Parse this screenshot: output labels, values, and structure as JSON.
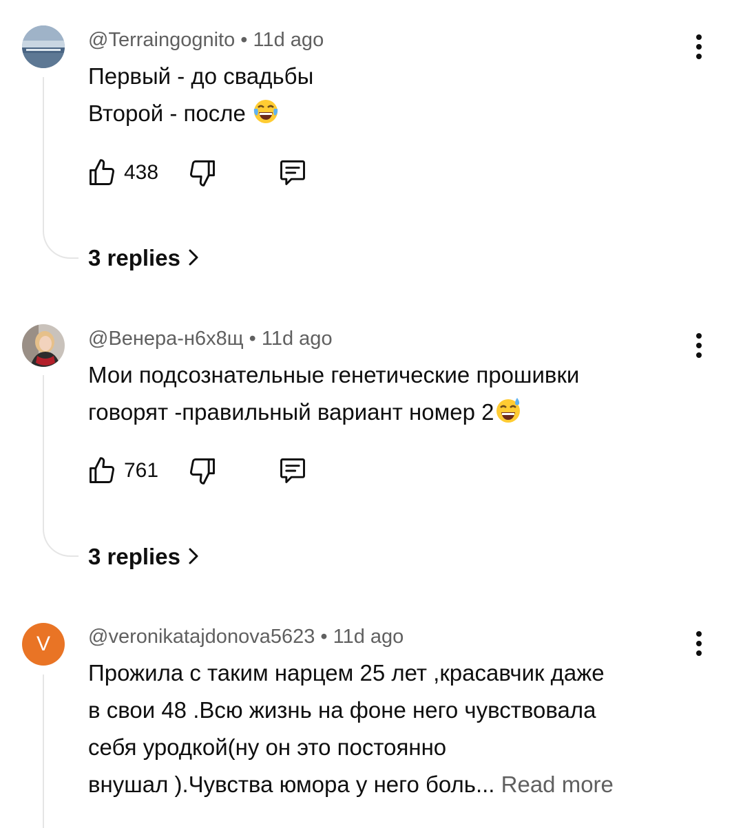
{
  "comments": [
    {
      "author": "@Terraingognito",
      "sep": " • ",
      "time": "11d ago",
      "lines": [
        "Первый - до свадьбы",
        "Второй - после"
      ],
      "emoji": "tears-of-joy-emoji",
      "likes": "438",
      "replies_label": "3 replies"
    },
    {
      "author": "@Венера-н6х8щ",
      "sep": " • ",
      "time": "11d ago",
      "lines": [
        "Мои подсознательные генетические прошивки",
        "говорят -правильный вариант номер 2"
      ],
      "emoji": "grinning-sweat-emoji",
      "likes": "761",
      "replies_label": "3 replies"
    },
    {
      "author": "@veronikatajdonova5623",
      "sep": " • ",
      "time": "11d ago",
      "avatar_letter": "V",
      "lines": [
        "Прожила с таким нарцем 25 лет ,красавчик даже",
        "в свои 48 .Всю жизнь на фоне него чувствовала",
        "себя уродкой(ну он это постоянно",
        "внушал ).Чувства юмора у него боль... "
      ],
      "read_more": "Read more"
    }
  ],
  "icons": {
    "like": "thumbs-up-icon",
    "dislike": "thumbs-down-icon",
    "reply": "comment-icon",
    "more": "more-vertical-icon",
    "chevron": "chevron-right-icon"
  },
  "colors": {
    "text": "#0f0f0f",
    "secondary": "#606060",
    "avatar_v": "#e97425",
    "thread": "#e5e5e5"
  }
}
